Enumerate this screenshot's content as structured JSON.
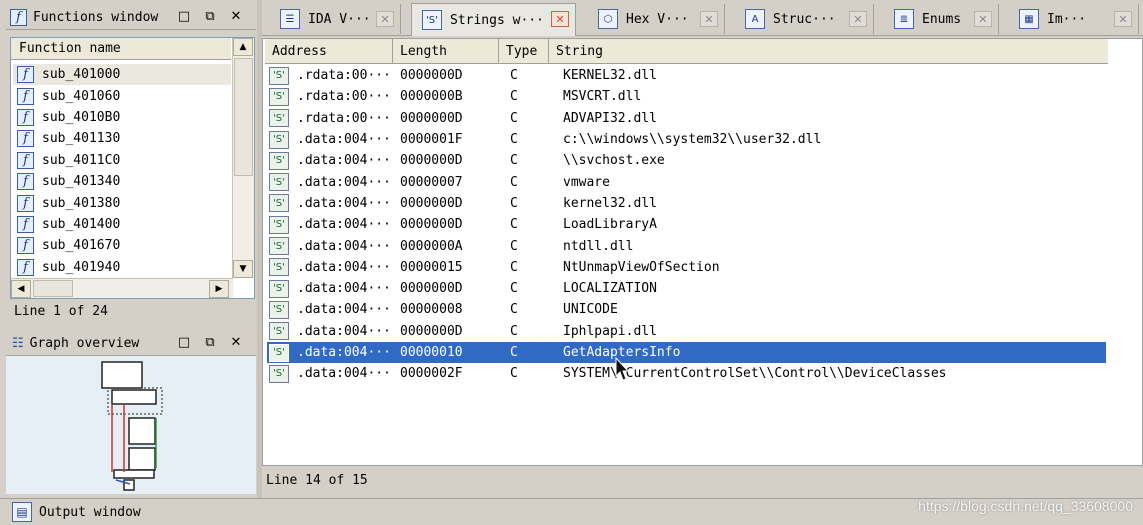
{
  "functions_window": {
    "title": "Functions window",
    "header": "Function name",
    "items": [
      "sub_401000",
      "sub_401060",
      "sub_4010B0",
      "sub_401130",
      "sub_4011C0",
      "sub_401340",
      "sub_401380",
      "sub_401400",
      "sub_401670",
      "sub_401940"
    ],
    "status": "Line 1 of 24"
  },
  "graph_overview": {
    "title": "Graph overview"
  },
  "tabs": [
    {
      "label": "IDA V···",
      "icon": "ida-view-icon",
      "active": false
    },
    {
      "label": "Strings w···",
      "icon": "strings-icon",
      "active": true
    },
    {
      "label": "Hex V···",
      "icon": "hex-view-icon",
      "active": false
    },
    {
      "label": "Struc···",
      "icon": "structures-icon",
      "active": false
    },
    {
      "label": "Enums",
      "icon": "enums-icon",
      "active": false
    },
    {
      "label": "Im···",
      "icon": "imports-icon",
      "active": false
    }
  ],
  "strings_window": {
    "columns": {
      "address": "Address",
      "length": "Length",
      "type": "Type",
      "string": "String"
    },
    "rows": [
      {
        "address": ".rdata:00···",
        "length": "0000000D",
        "type": "C",
        "string": "KERNEL32.dll"
      },
      {
        "address": ".rdata:00···",
        "length": "0000000B",
        "type": "C",
        "string": "MSVCRT.dll"
      },
      {
        "address": ".rdata:00···",
        "length": "0000000D",
        "type": "C",
        "string": "ADVAPI32.dll"
      },
      {
        "address": ".data:004···",
        "length": "0000001F",
        "type": "C",
        "string": "c:\\\\windows\\\\system32\\\\user32.dll"
      },
      {
        "address": ".data:004···",
        "length": "0000000D",
        "type": "C",
        "string": "\\\\svchost.exe"
      },
      {
        "address": ".data:004···",
        "length": "00000007",
        "type": "C",
        "string": "vmware"
      },
      {
        "address": ".data:004···",
        "length": "0000000D",
        "type": "C",
        "string": "kernel32.dll"
      },
      {
        "address": ".data:004···",
        "length": "0000000D",
        "type": "C",
        "string": "LoadLibraryA"
      },
      {
        "address": ".data:004···",
        "length": "0000000A",
        "type": "C",
        "string": "ntdll.dll"
      },
      {
        "address": ".data:004···",
        "length": "00000015",
        "type": "C",
        "string": "NtUnmapViewOfSection"
      },
      {
        "address": ".data:004···",
        "length": "0000000D",
        "type": "C",
        "string": "LOCALIZATION"
      },
      {
        "address": ".data:004···",
        "length": "00000008",
        "type": "C",
        "string": "UNICODE"
      },
      {
        "address": ".data:004···",
        "length": "0000000D",
        "type": "C",
        "string": "Iphlpapi.dll"
      },
      {
        "address": ".data:004···",
        "length": "00000010",
        "type": "C",
        "string": "GetAdaptersInfo",
        "selected": true
      },
      {
        "address": ".data:004···",
        "length": "0000002F",
        "type": "C",
        "string": "SYSTEM\\\\CurrentControlSet\\\\Control\\\\DeviceClasses"
      }
    ],
    "status": "Line 14 of 15"
  },
  "output_window": {
    "title": "Output window"
  },
  "watermark": "https://blog.csdn.net/qq_33608000",
  "colors": {
    "selection": "#316ac5",
    "chrome": "#d4d0c8",
    "active_close": "#d24a2a"
  }
}
